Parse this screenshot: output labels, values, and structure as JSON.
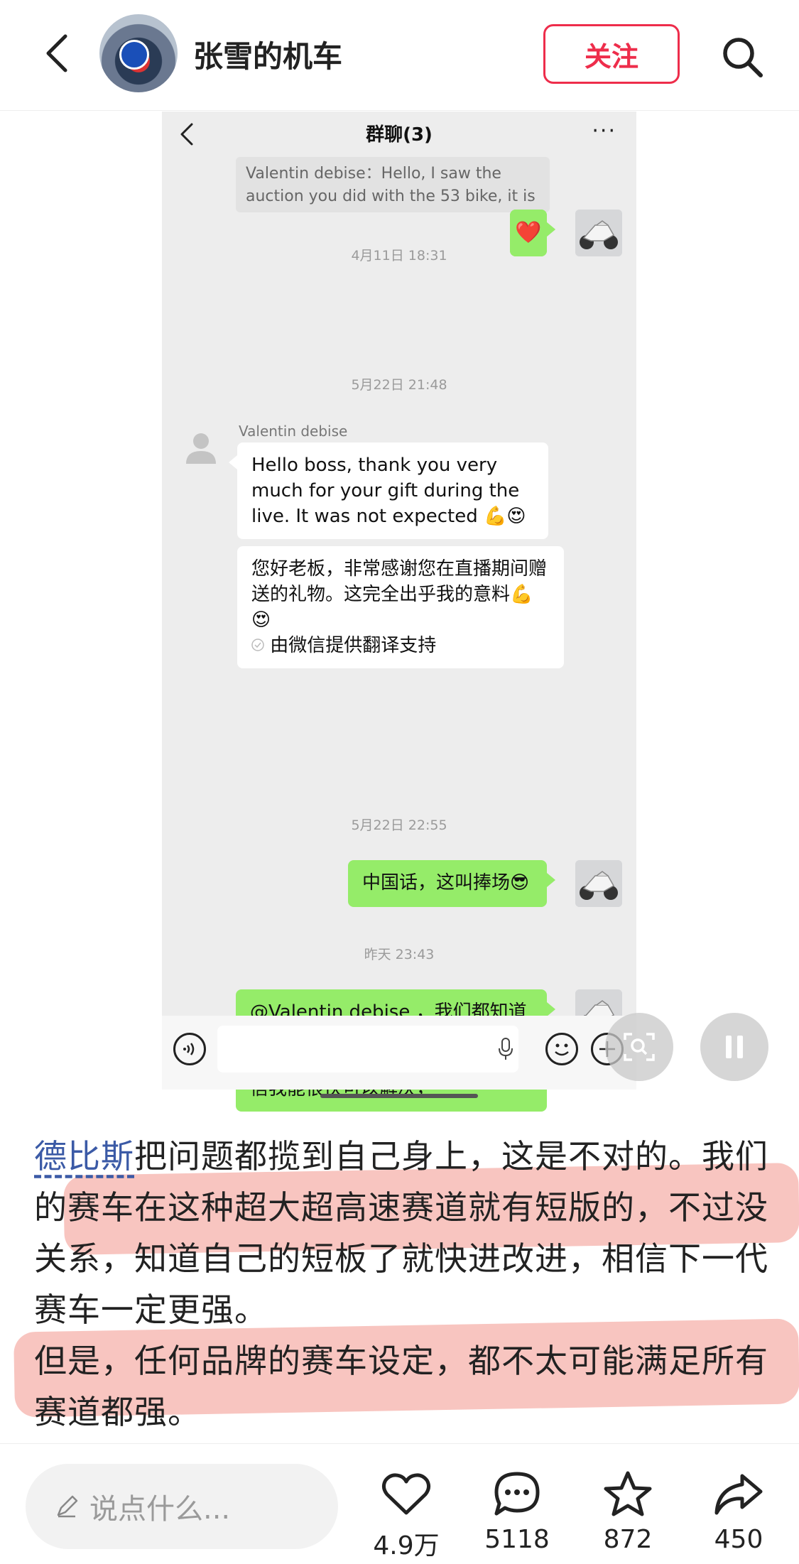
{
  "header": {
    "author_name": "张雪的机车",
    "follow_label": "关注"
  },
  "chat": {
    "title": "群聊(3)",
    "more": "···",
    "quote_text": "Valentin debise：Hello, I saw the auction you did with the 53 bike, it is ...",
    "timestamps": [
      "4月11日 18:31",
      "5月22日 21:48",
      "5月22日 22:55",
      "昨天 23:43"
    ],
    "sender_name": "Valentin debise",
    "heart_emoji": "❤️",
    "msg_en": "Hello boss, thank you very much for your gift during the live. It was not expected 💪😍",
    "msg_translation": "您好老板，非常感谢您在直播期间赠送的礼物。这完全出乎我的意料💪😍",
    "translation_note": "由微信提供翻译支持",
    "msg_reply1": "中国话，这叫捧场😎",
    "msg_reply2": "@Valentin debise ，我们都知道你已经非常努力了，我们的赛车在这个赛道有明显的短板，但是我相信我能很快可以解决，"
  },
  "post": {
    "tag": "德比斯",
    "text": "把问题都揽到自己身上，这是不对的。我们的赛车在这种超大超高速赛道就有短版的，不过没关系，知道自己的短板了就快进改进，相信下一代赛车一定更强。",
    "text2": "但是，任何品牌的赛车设定，都不太可能满足所有赛道都强。"
  },
  "bottom": {
    "comment_placeholder": "说点什么...",
    "likes": "4.9万",
    "comments": "5118",
    "favorites": "872",
    "shares": "450"
  },
  "colors": {
    "accent": "#ee2d4b",
    "wechat_green": "#95ec69",
    "highlight": "#f3968c",
    "tag_blue": "#3b5aa6"
  }
}
